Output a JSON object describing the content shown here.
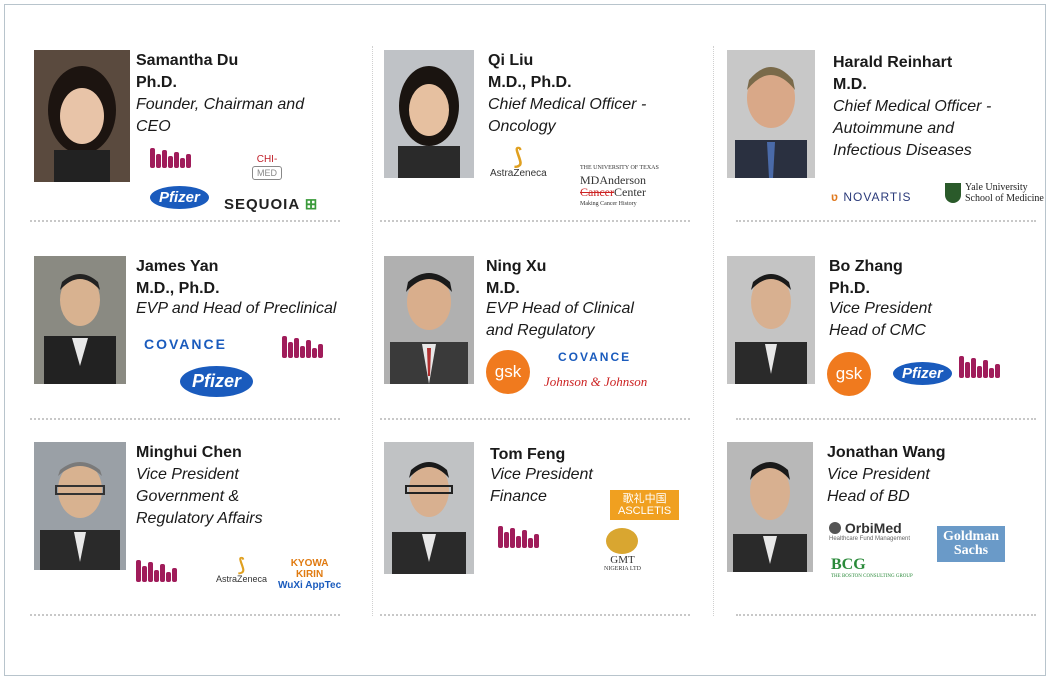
{
  "people": [
    {
      "name": "Samantha Du",
      "degree": "Ph.D.",
      "title_lines": [
        "Founder, Chairman and",
        "CEO"
      ]
    },
    {
      "name": "Qi Liu",
      "degree": "M.D., Ph.D.",
      "title_lines": [
        "Chief Medical Officer -",
        "Oncology"
      ]
    },
    {
      "name": "Harald Reinhart",
      "degree": "M.D.",
      "title_lines": [
        "Chief Medical Officer -",
        "Autoimmune and",
        "Infectious Diseases"
      ]
    },
    {
      "name": "James Yan",
      "degree": "M.D., Ph.D.",
      "title_lines": [
        "EVP and Head of Preclinical"
      ]
    },
    {
      "name": "Ning Xu",
      "degree": "M.D.",
      "title_lines": [
        "EVP Head of Clinical",
        "and Regulatory"
      ]
    },
    {
      "name": "Bo Zhang",
      "degree": "Ph.D.",
      "title_lines": [
        "Vice President",
        "Head of CMC"
      ]
    },
    {
      "name": "Minghui Chen",
      "degree": "",
      "title_lines": [
        "Vice President",
        "Government &",
        "Regulatory Affairs"
      ]
    },
    {
      "name": "Tom Feng",
      "degree": "",
      "title_lines": [
        "Vice President",
        "Finance"
      ]
    },
    {
      "name": "Jonathan Wang",
      "degree": "",
      "title_lines": [
        "Vice President",
        "Head of BD"
      ]
    }
  ],
  "logos": {
    "pfizer": "Pfizer",
    "sequoia": "SEQUOIA",
    "chimed_top": "CHI-",
    "chimed_box": "MED",
    "astrazeneca": "AstraZeneca",
    "mda_small": "THE UNIVERSITY OF TEXAS",
    "mda_line1": "MDAnderson",
    "mda_line2a": "Cancer",
    "mda_line2b": "Center",
    "mda_tag": "Making Cancer History",
    "novartis": "NOVARTIS",
    "yale_line1": "Yale University",
    "yale_line2": "School of Medicine",
    "covance": "COVANCE",
    "gsk": "gsk",
    "jnj": "Johnson & Johnson",
    "kyowa_top": "KYOWA",
    "kyowa_mid": "KIRIN",
    "kyowa_sub": "WuXi AppTec",
    "ascletis_cn": "歌礼中国",
    "ascletis": "ASCLETIS",
    "gmt": "GMT",
    "gmt_sub": "NIGERIA LTD",
    "orbimed": "OrbiMed",
    "orbimed_sub": "Healthcare Fund Management",
    "bcg": "BCG",
    "bcg_sub": "THE BOSTON CONSULTING GROUP",
    "gs_line1": "Goldman",
    "gs_line2": "Sachs"
  }
}
